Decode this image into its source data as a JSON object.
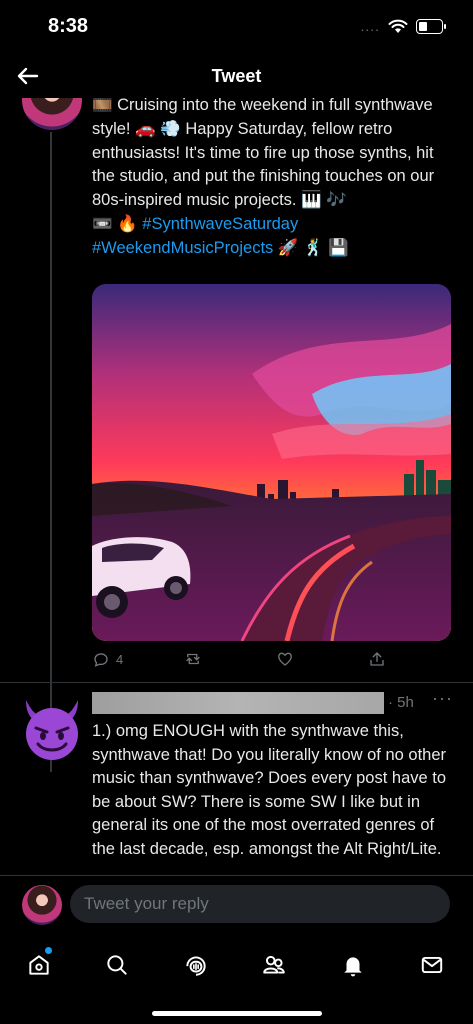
{
  "status_bar": {
    "time": "8:38",
    "signal": "....",
    "icons": [
      "wifi-icon",
      "battery-icon"
    ]
  },
  "nav": {
    "title": "Tweet",
    "back_icon": "arrow-left-icon"
  },
  "tweet": {
    "text_line1": "🎞️ Cruising into the weekend in full synthwave style! 🚗 💨 Happy Saturday, fellow retro enthusiasts! It's time to fire up those synths, hit the studio, and put the finishing touches on our 80s-inspired music projects. 🎹 🎶",
    "tag_prefix": "📼 🔥 ",
    "hashtag1": "#SynthwaveSaturday",
    "hashtag2": "#WeekendMusicProjects",
    "tag_suffix": " 🚀 🕺 💾",
    "reply_count": "4",
    "actions": [
      "reply-icon",
      "retweet-icon",
      "like-icon",
      "share-icon"
    ]
  },
  "reply": {
    "time": "· 5h",
    "more": "···",
    "text": "1.) omg ENOUGH with the synthwave this, synthwave that! Do you literally know of no other music than synthwave? Does every post have to be about SW? There is some SW I like but in general its one of the most overrated genres of the last decade, esp. amongst the Alt Right/Lite."
  },
  "composer": {
    "placeholder": "Tweet your reply"
  },
  "tabs": [
    "home-icon",
    "search-icon",
    "spaces-icon",
    "communities-icon",
    "notifications-icon",
    "messages-icon"
  ],
  "colors": {
    "background": "#000000",
    "accent": "#1d9bf0",
    "muted": "#71767b",
    "text": "#e7e9ea"
  }
}
